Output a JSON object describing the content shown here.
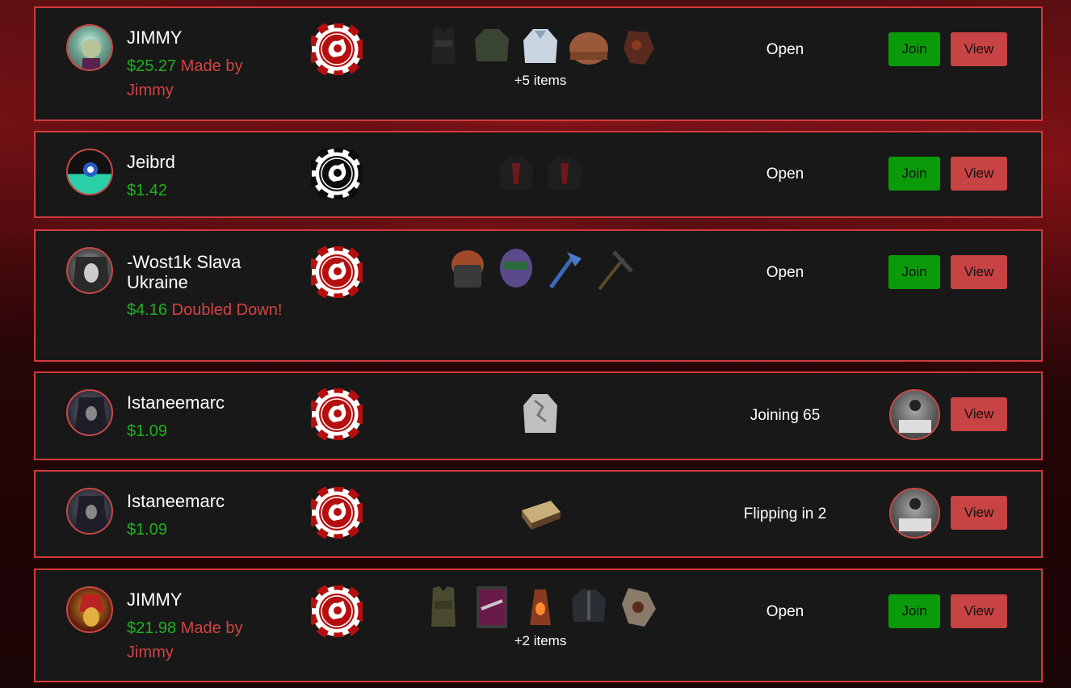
{
  "rows": [
    {
      "user": "JIMMY",
      "price": "$25.27",
      "tag": "Made by Jimmy",
      "more": "+5 items",
      "status": "Open",
      "join": "Join",
      "view": "View"
    },
    {
      "user": "Jeibrd",
      "price": "$1.42",
      "tag": "",
      "more": "",
      "status": "Open",
      "join": "Join",
      "view": "View"
    },
    {
      "user": "-Wost1k Slava Ukraine",
      "price": "$4.16",
      "tag": "Doubled Down!",
      "more": "",
      "status": "Open",
      "join": "Join",
      "view": "View"
    },
    {
      "user": "Istaneemarc",
      "price": "$1.09",
      "tag": "",
      "more": "",
      "status": "Joining 65",
      "view": "View"
    },
    {
      "user": "Istaneemarc",
      "price": "$1.09",
      "tag": "",
      "more": "",
      "status": "Flipping in 2",
      "view": "View"
    },
    {
      "user": "JIMMY",
      "price": "$21.98",
      "tag": "Made by Jimmy",
      "more": "+2 items",
      "status": "Open",
      "join": "Join",
      "view": "View"
    }
  ],
  "colors": {
    "accent": "#d03b3b",
    "join": "#0a9a0a",
    "view": "#c84343",
    "price": "#1fb11f",
    "tag": "#d44343",
    "coin_red": "#b50f0f",
    "coin_black": "#0d0d0d"
  }
}
